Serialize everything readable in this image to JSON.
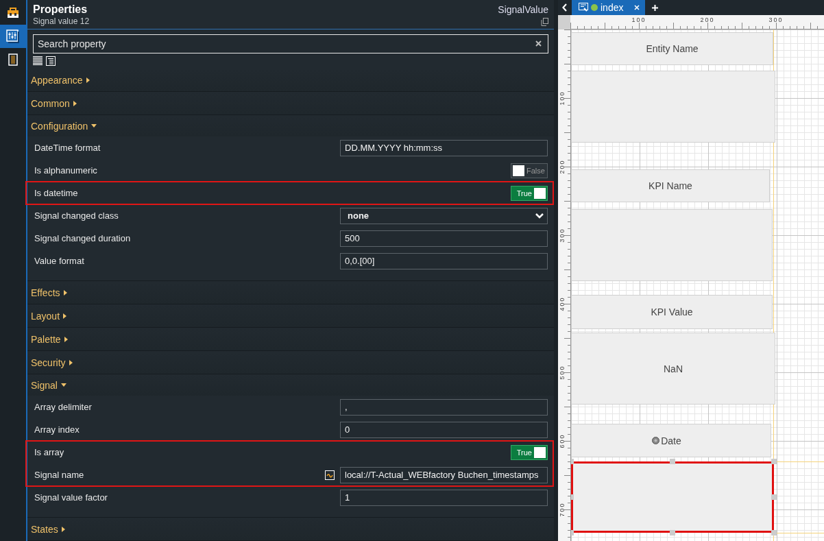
{
  "sidebar": {
    "items": [
      {
        "kind": "toolbox",
        "selected": false
      },
      {
        "kind": "properties",
        "selected": true
      },
      {
        "kind": "book",
        "selected": false
      }
    ]
  },
  "properties": {
    "title": "Properties",
    "subtitle": "Signal value 12",
    "type": "SignalValue",
    "search": {
      "placeholder": "Search property"
    },
    "sections": [
      {
        "title": "Appearance",
        "expanded": false
      },
      {
        "title": "Common",
        "expanded": false
      },
      {
        "title": "Configuration",
        "expanded": true,
        "rows": [
          {
            "kind": "text",
            "label": "DateTime format",
            "value": "DD.MM.YYYY hh:mm:ss",
            "highlighted": false
          },
          {
            "kind": "toggle",
            "label": "Is alphanumeric",
            "on": false,
            "state_text": "False",
            "highlighted": false
          },
          {
            "kind": "toggle",
            "label": "Is datetime",
            "on": true,
            "state_text": "True",
            "highlighted": true
          },
          {
            "kind": "select",
            "label": "Signal changed class",
            "value": "none",
            "highlighted": false
          },
          {
            "kind": "text",
            "label": "Signal changed duration",
            "value": "500",
            "highlighted": false
          },
          {
            "kind": "text",
            "label": "Value format",
            "value": "0,0.[00]",
            "highlighted": false
          }
        ]
      },
      {
        "title": "Effects",
        "expanded": false
      },
      {
        "title": "Layout",
        "expanded": false
      },
      {
        "title": "Palette",
        "expanded": false
      },
      {
        "title": "Security",
        "expanded": false
      },
      {
        "title": "Signal",
        "expanded": true,
        "rows": [
          {
            "kind": "text",
            "label": "Array delimiter",
            "value": ",",
            "highlighted": false
          },
          {
            "kind": "text",
            "label": "Array index",
            "value": "0",
            "highlighted": false
          },
          {
            "kind": "toggle",
            "label": "Is array",
            "on": true,
            "state_text": "True",
            "highlighted": true
          },
          {
            "kind": "signal",
            "label": "Signal name",
            "value": "local://T-Actual_WEBfactory Buchen_timestamps",
            "highlighted": true
          },
          {
            "kind": "text",
            "label": "Signal value factor",
            "value": "1",
            "highlighted": false
          }
        ]
      },
      {
        "title": "States",
        "expanded": false
      }
    ]
  },
  "editor": {
    "tabs": [
      {
        "title": "index",
        "selected": true
      }
    ],
    "ruler": {
      "x_labels": [
        "100",
        "200",
        "300"
      ],
      "y_labels": [
        "100",
        "200",
        "300",
        "400",
        "500",
        "600",
        "700"
      ]
    },
    "widgets": [
      {
        "label": "Entity Name",
        "selected": false
      },
      {
        "selected": false
      },
      {
        "label": "KPI Name",
        "selected": false
      },
      {
        "selected": false
      },
      {
        "label": "KPI Value",
        "selected": false
      },
      {
        "label": "NaN",
        "selected": false
      },
      {
        "label": "Date",
        "selected": false
      },
      {
        "selected": true
      }
    ]
  }
}
